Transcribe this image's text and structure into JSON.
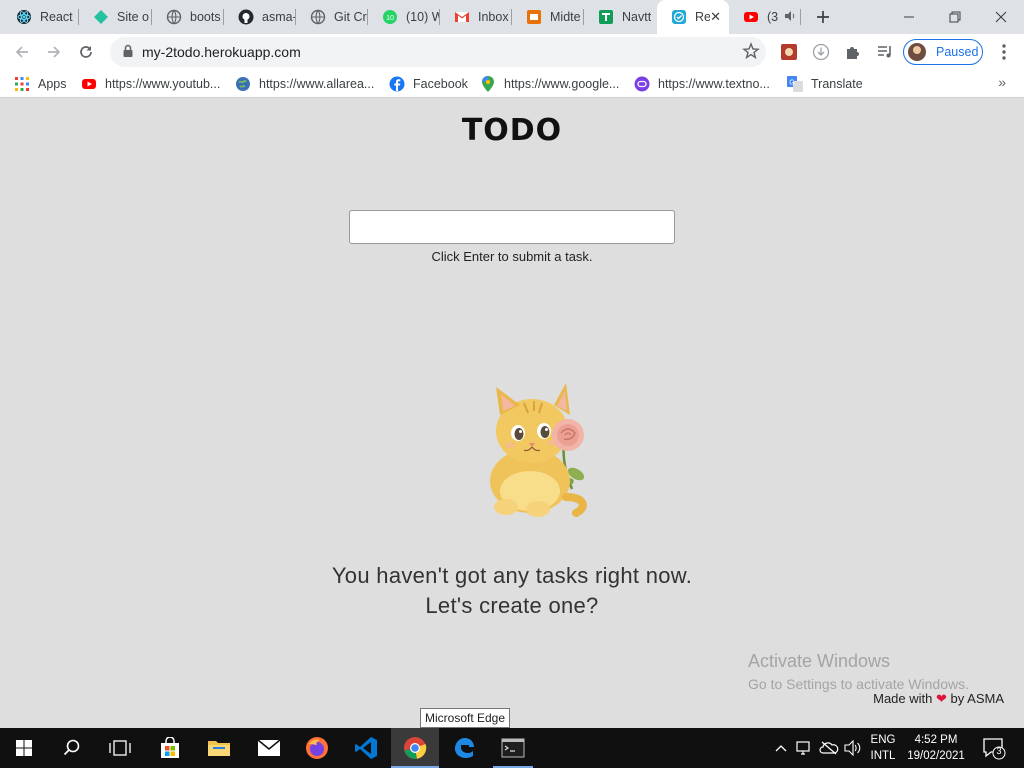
{
  "browser": {
    "tabs": [
      {
        "label": "React",
        "icon": "react-icon"
      },
      {
        "label": "Site o",
        "icon": "diamond-icon"
      },
      {
        "label": "boots",
        "icon": "globe-icon"
      },
      {
        "label": "asma-",
        "icon": "github-icon"
      },
      {
        "label": "Git Cr",
        "icon": "globe-icon"
      },
      {
        "label": "(10) W",
        "icon": "whatsapp-icon"
      },
      {
        "label": "Inbox",
        "icon": "gmail-icon"
      },
      {
        "label": "Midte",
        "icon": "slides-icon"
      },
      {
        "label": "Navtt",
        "icon": "sheets-icon"
      },
      {
        "label": "Re",
        "icon": "todo-check-icon",
        "active": true
      },
      {
        "label": "(3",
        "icon": "youtube-icon"
      }
    ],
    "url": "my-2todo.herokuapp.com",
    "profile_label": "Paused",
    "bookmarks": [
      {
        "label": "Apps",
        "icon": "apps-grid-icon"
      },
      {
        "label": "https://www.youtub...",
        "icon": "youtube-icon"
      },
      {
        "label": "https://www.allarea...",
        "icon": "globe-icon"
      },
      {
        "label": "Facebook",
        "icon": "facebook-icon"
      },
      {
        "label": "https://www.google...",
        "icon": "maps-icon"
      },
      {
        "label": "https://www.textno...",
        "icon": "textnow-icon"
      },
      {
        "label": "Translate",
        "icon": "translate-icon"
      }
    ]
  },
  "app": {
    "title": "TODO",
    "input_placeholder": "",
    "hint": "Click Enter to submit a task.",
    "empty_line1": "You haven't got any tasks right now.",
    "empty_line2": "Let's create one?",
    "footer_prefix": "Made with",
    "footer_suffix": "by ASMA"
  },
  "watermark": {
    "title": "Activate Windows",
    "subtitle": "Go to Settings to activate Windows."
  },
  "tooltip": "Microsoft Edge",
  "taskbar": {
    "lang_line1": "ENG",
    "lang_line2": "INTL",
    "time": "4:52 PM",
    "date": "19/02/2021",
    "notification_count": "3"
  }
}
